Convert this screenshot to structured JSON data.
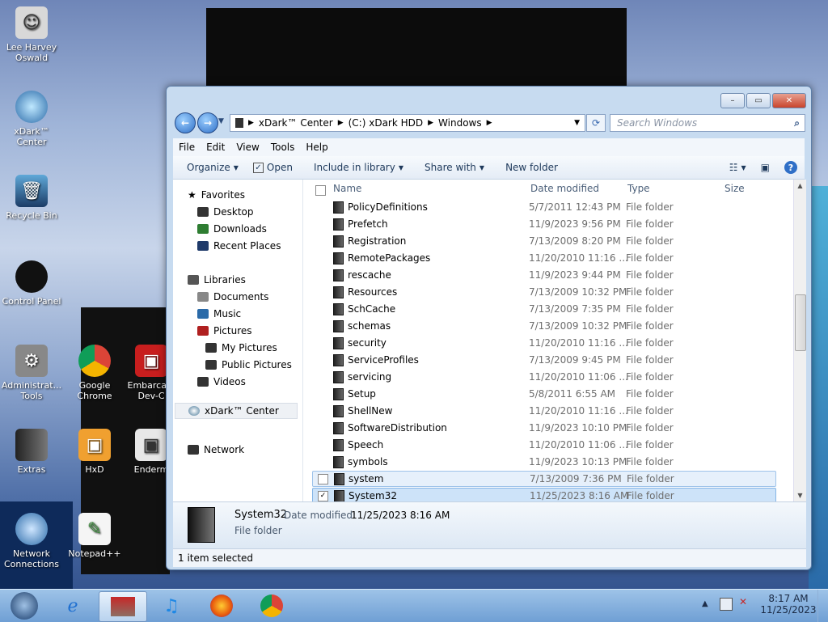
{
  "desktop": {
    "icons": [
      {
        "label": "Lee Harvey Oswald",
        "icon": "anime-figure-icon"
      },
      {
        "label": "xDark™ Center",
        "icon": "xdark-center-icon"
      },
      {
        "label": "Recycle Bin",
        "icon": "recycle-bin-icon"
      },
      {
        "label": "Control Panel",
        "icon": "control-panel-icon"
      },
      {
        "label": "Administrat... Tools",
        "icon": "admin-tools-icon"
      },
      {
        "label": "Google Chrome",
        "icon": "chrome-icon"
      },
      {
        "label": "Embarca... Dev-C",
        "icon": "devc-icon"
      },
      {
        "label": "Extras",
        "icon": "extras-folder-icon"
      },
      {
        "label": "HxD",
        "icon": "hxd-icon"
      },
      {
        "label": "Enderm",
        "icon": "enderm-icon"
      },
      {
        "label": "Network Connections",
        "icon": "network-connections-icon"
      },
      {
        "label": "Notepad++",
        "icon": "notepadpp-icon"
      }
    ]
  },
  "window": {
    "caption_buttons": [
      "–",
      "▭",
      "✕"
    ],
    "address": {
      "crumbs": [
        "xDark™ Center",
        "(C:) xDark HDD",
        "Windows"
      ]
    },
    "search_placeholder": "Search Windows",
    "menu": [
      "File",
      "Edit",
      "View",
      "Tools",
      "Help"
    ],
    "toolbar": {
      "organize": "Organize",
      "open": "Open",
      "include": "Include in library",
      "share": "Share with",
      "new_folder": "New folder"
    },
    "nav": {
      "favorites": "Favorites",
      "desktop": "Desktop",
      "downloads": "Downloads",
      "recent": "Recent Places",
      "libraries": "Libraries",
      "documents": "Documents",
      "music": "Music",
      "pictures": "Pictures",
      "my_pictures": "My Pictures",
      "public_pictures": "Public Pictures",
      "videos": "Videos",
      "xdark": "xDark™ Center",
      "network": "Network"
    },
    "columns": {
      "name": "Name",
      "date": "Date modified",
      "type": "Type",
      "size": "Size"
    },
    "files": [
      {
        "name": "PolicyDefinitions",
        "date": "5/7/2011 12:43 PM",
        "type": "File folder"
      },
      {
        "name": "Prefetch",
        "date": "11/9/2023 9:56 PM",
        "type": "File folder"
      },
      {
        "name": "Registration",
        "date": "7/13/2009 8:20 PM",
        "type": "File folder"
      },
      {
        "name": "RemotePackages",
        "date": "11/20/2010 11:16 ...",
        "type": "File folder"
      },
      {
        "name": "rescache",
        "date": "11/9/2023 9:44 PM",
        "type": "File folder"
      },
      {
        "name": "Resources",
        "date": "7/13/2009 10:32 PM",
        "type": "File folder"
      },
      {
        "name": "SchCache",
        "date": "7/13/2009 7:35 PM",
        "type": "File folder"
      },
      {
        "name": "schemas",
        "date": "7/13/2009 10:32 PM",
        "type": "File folder"
      },
      {
        "name": "security",
        "date": "11/20/2010 11:16 ...",
        "type": "File folder"
      },
      {
        "name": "ServiceProfiles",
        "date": "7/13/2009 9:45 PM",
        "type": "File folder"
      },
      {
        "name": "servicing",
        "date": "11/20/2010 11:06 ...",
        "type": "File folder"
      },
      {
        "name": "Setup",
        "date": "5/8/2011 6:55 AM",
        "type": "File folder"
      },
      {
        "name": "ShellNew",
        "date": "11/20/2010 11:16 ...",
        "type": "File folder"
      },
      {
        "name": "SoftwareDistribution",
        "date": "11/9/2023 10:10 PM",
        "type": "File folder"
      },
      {
        "name": "Speech",
        "date": "11/20/2010 11:06 ...",
        "type": "File folder"
      },
      {
        "name": "symbols",
        "date": "11/9/2023 10:13 PM",
        "type": "File folder"
      },
      {
        "name": "system",
        "date": "7/13/2009 7:36 PM",
        "type": "File folder"
      },
      {
        "name": "System32",
        "date": "11/25/2023 8:16 AM",
        "type": "File folder"
      }
    ],
    "details": {
      "name": "System32",
      "date_label": "Date modified:",
      "date": "11/25/2023 8:16 AM",
      "type": "File folder"
    },
    "status": "1 item selected"
  },
  "taskbar": {
    "apps": [
      "start-orb-icon",
      "internet-explorer-icon",
      "file-manager-icon",
      "music-icon",
      "firefox-icon",
      "chrome-icon"
    ],
    "time": "8:17 AM",
    "date": "11/25/2023"
  }
}
